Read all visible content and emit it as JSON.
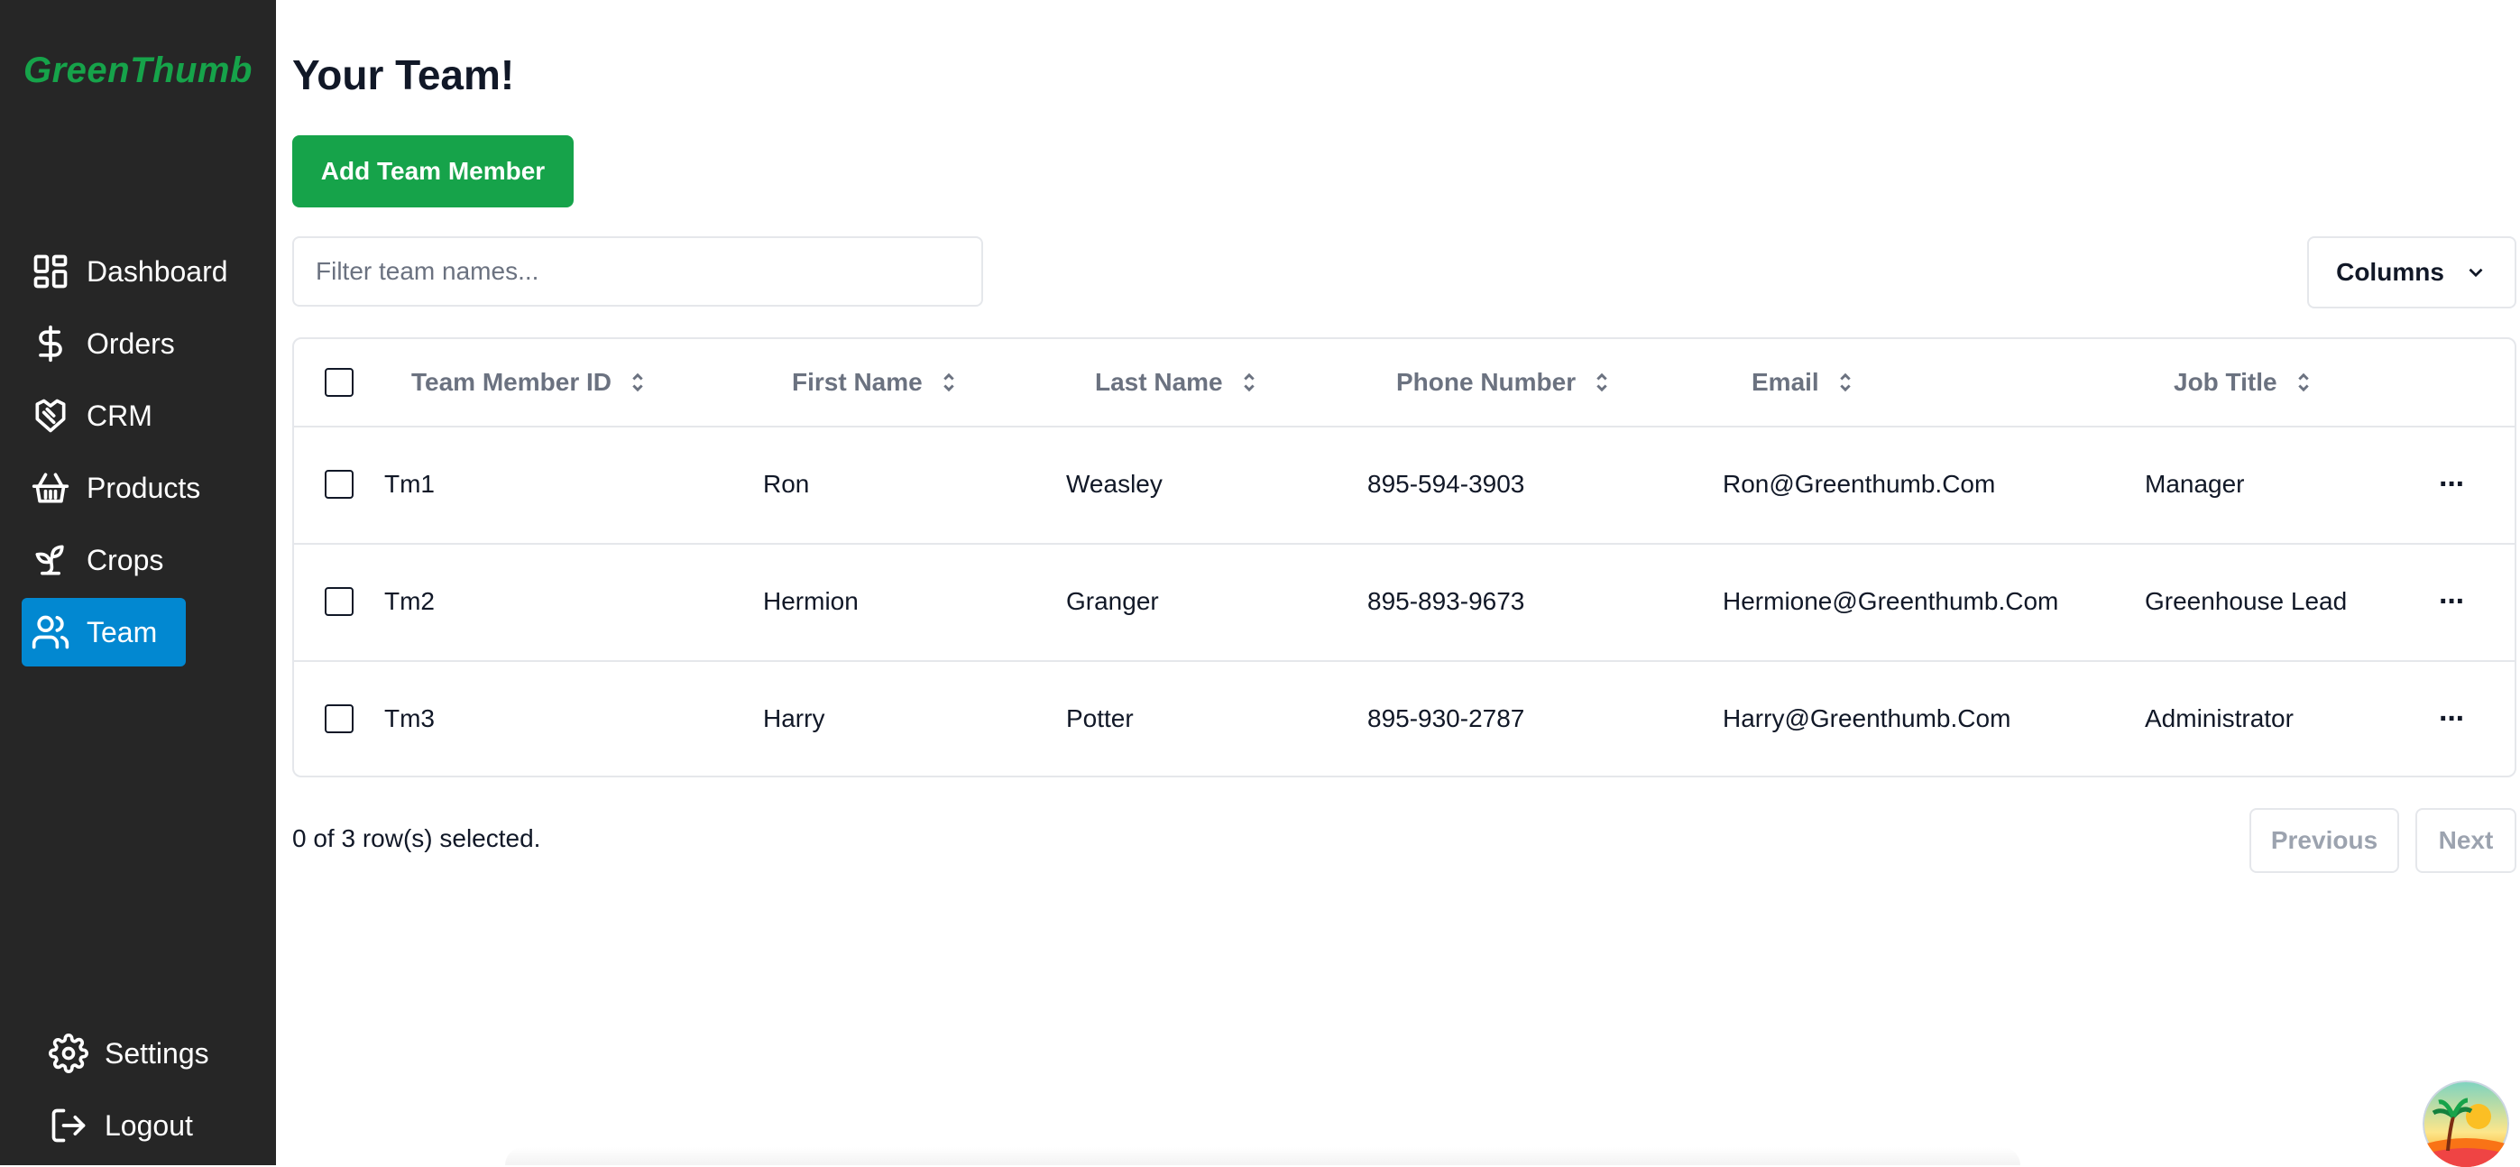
{
  "app": {
    "brand": "GreenThumb"
  },
  "sidebar": {
    "items": [
      {
        "label": "Dashboard",
        "icon": "dashboard-icon"
      },
      {
        "label": "Orders",
        "icon": "dollar-icon"
      },
      {
        "label": "CRM",
        "icon": "handshake-icon"
      },
      {
        "label": "Products",
        "icon": "basket-icon"
      },
      {
        "label": "Crops",
        "icon": "sprout-icon"
      },
      {
        "label": "Team",
        "icon": "users-icon",
        "active": true
      }
    ],
    "bottom": [
      {
        "label": "Settings",
        "icon": "gear-icon"
      },
      {
        "label": "Logout",
        "icon": "logout-icon"
      }
    ]
  },
  "page": {
    "title": "Your Team!",
    "add_button": "Add Team Member",
    "filter_placeholder": "Filter team names...",
    "columns_button": "Columns"
  },
  "table": {
    "headers": [
      "Team Member ID",
      "First Name",
      "Last Name",
      "Phone Number",
      "Email",
      "Job Title"
    ],
    "rows": [
      {
        "id": "Tm1",
        "first": "Ron",
        "last": "Weasley",
        "phone": "895-594-3903",
        "email": "Ron@Greenthumb.Com",
        "job": "Manager"
      },
      {
        "id": "Tm2",
        "first": "Hermion",
        "last": "Granger",
        "phone": "895-893-9673",
        "email": "Hermione@Greenthumb.Com",
        "job": "Greenhouse Lead"
      },
      {
        "id": "Tm3",
        "first": "Harry",
        "last": "Potter",
        "phone": "895-930-2787",
        "email": "Harry@Greenthumb.Com",
        "job": "Administrator"
      }
    ],
    "row_actions": "···"
  },
  "footer": {
    "selected_text": "0 of 3 row(s) selected.",
    "previous": "Previous",
    "next": "Next"
  },
  "colors": {
    "sidebar_bg": "#262626",
    "brand": "#16a34a",
    "active_nav": "#0288d1",
    "primary_button": "#16a34a"
  }
}
